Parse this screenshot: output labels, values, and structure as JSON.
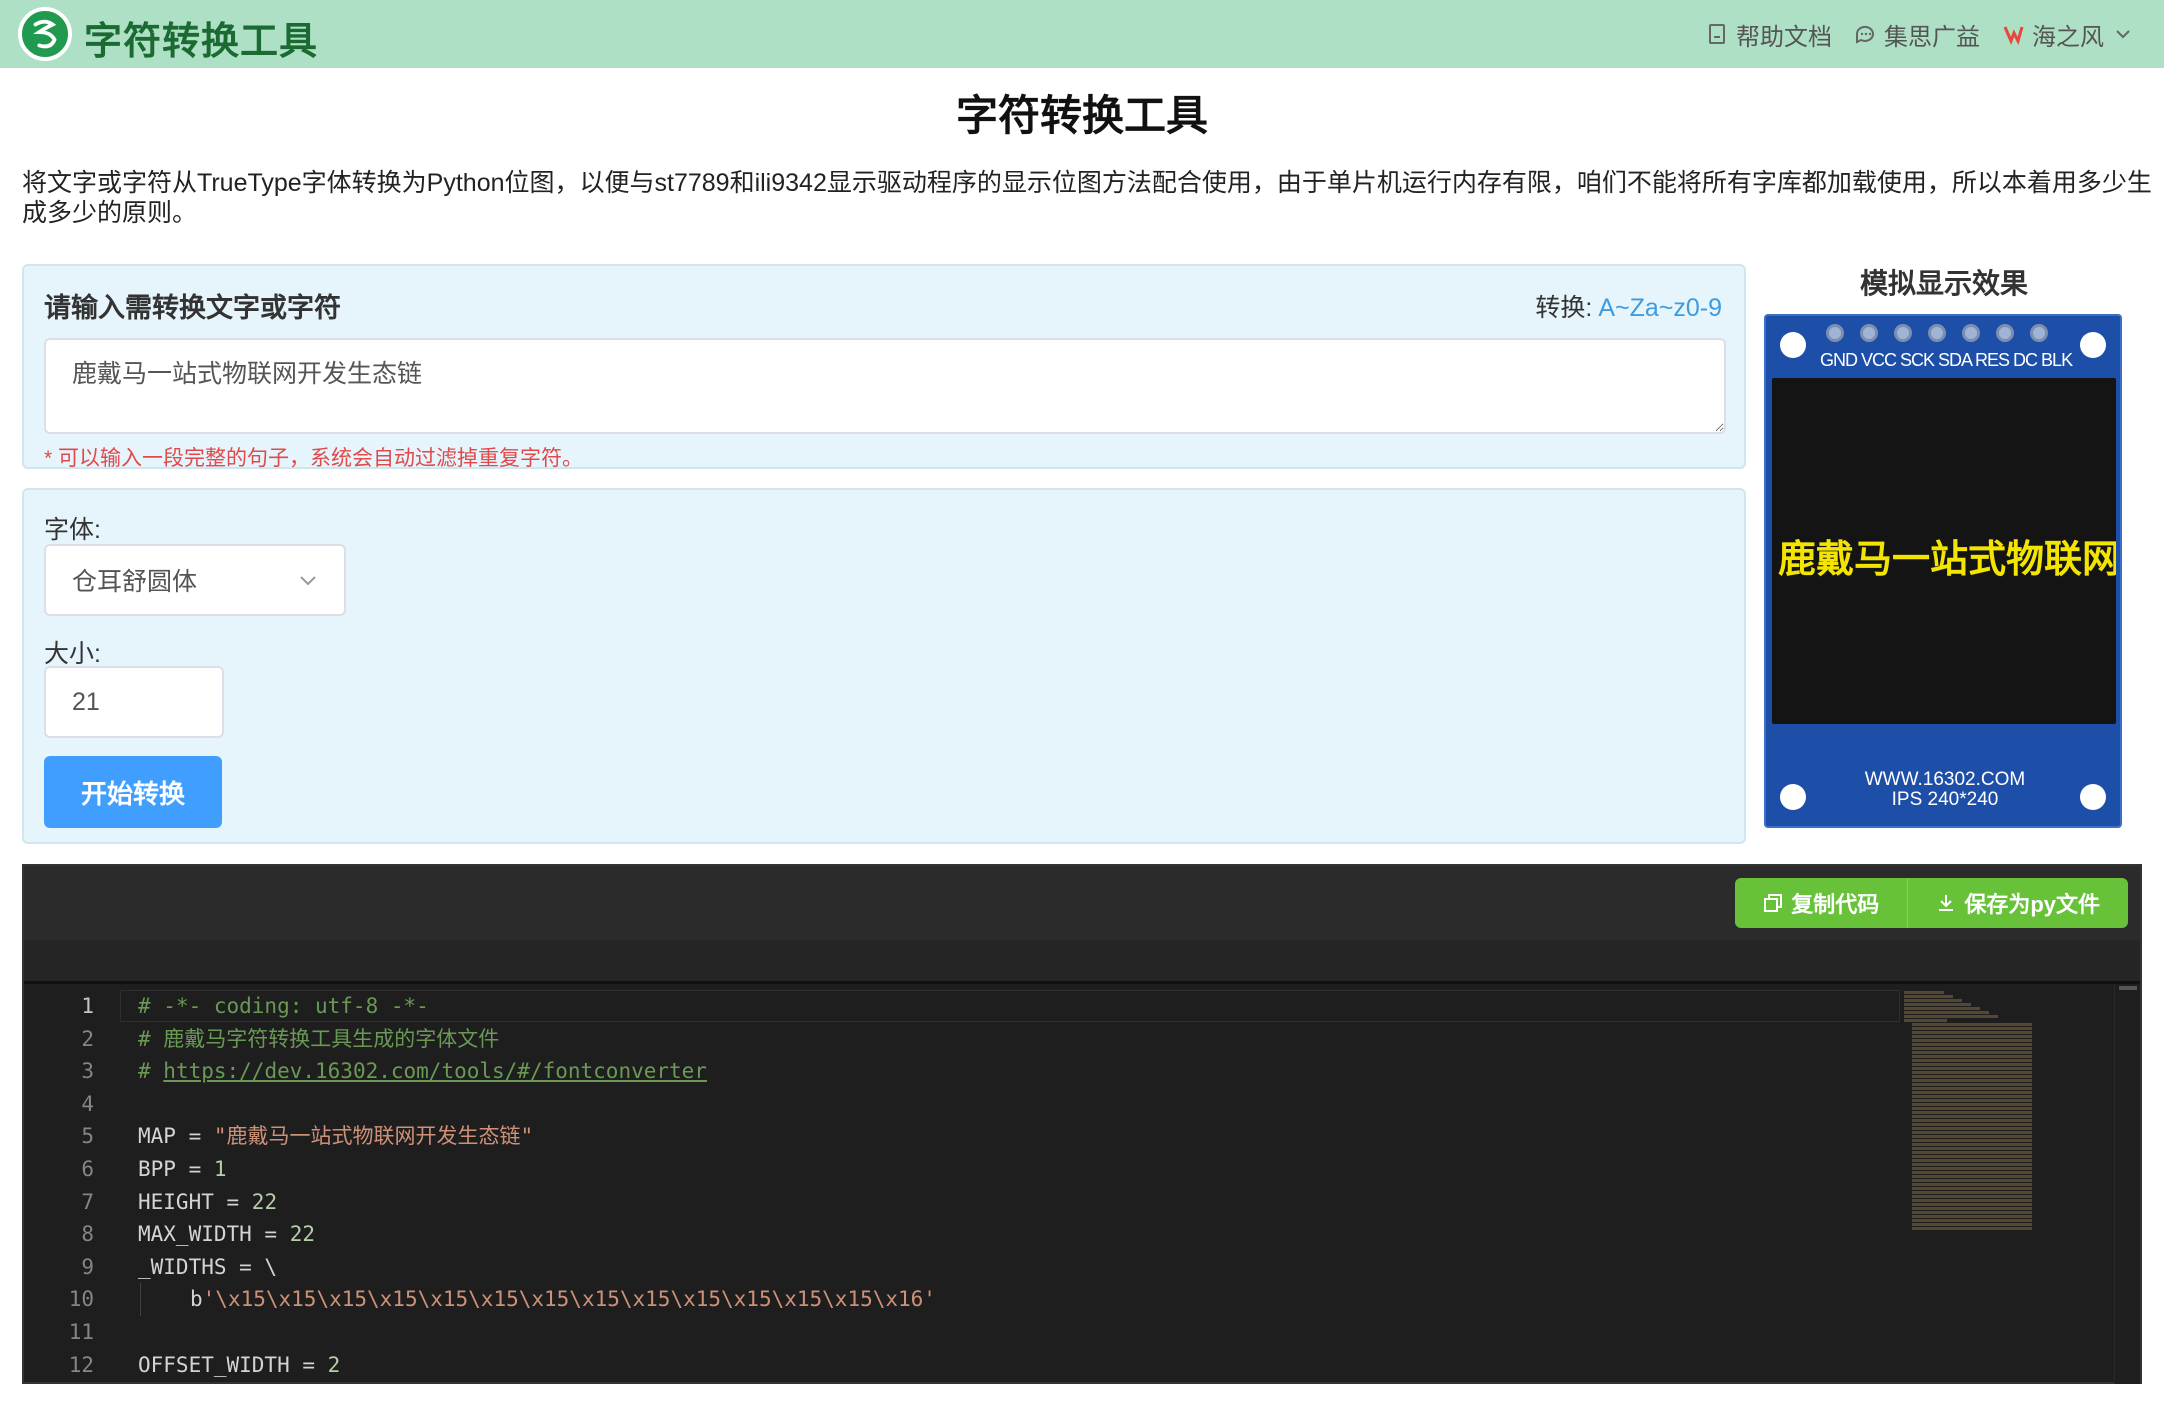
{
  "topbar": {
    "brand": "字符转换工具",
    "nav": [
      {
        "icon": "document-icon",
        "label": "帮助文档"
      },
      {
        "icon": "chat-icon",
        "label": "集思广益"
      },
      {
        "icon": "user-logo-icon",
        "label": "海之风"
      }
    ]
  },
  "page": {
    "title": "字符转换工具",
    "description": "将文字或字符从TrueType字体转换为Python位图，以便与st7789和ili9342显示驱动程序的显示位图方法配合使用，由于单片机运行内存有限，咱们不能将所有字库都加载使用，所以本着用多少生成多少的原则。"
  },
  "input_panel": {
    "title": "请输入需转换文字或字符",
    "convert_label": "转换:",
    "convert_link": "A~Za~z0-9",
    "text_value": "鹿戴马一站式物联网开发生态链",
    "hint": "* 可以输入一段完整的句子，系统会自动过滤掉重复字符。"
  },
  "settings_panel": {
    "font_label": "字体:",
    "font_value": "仓耳舒圆体",
    "size_label": "大小:",
    "size_value": "21",
    "start_button": "开始转换"
  },
  "preview": {
    "title": "模拟显示效果",
    "pin_labels": "GND VCC SCK SDA RES DC BLK",
    "screen_text": "鹿戴马一站式物联网",
    "bottom_line1": "WWW.16302.COM",
    "bottom_line2": "IPS 240*240"
  },
  "code": {
    "copy_button": "复制代码",
    "save_button": "保存为py文件",
    "lines": [
      {
        "n": "1",
        "text": "# -*- coding: utf-8 -*-"
      },
      {
        "n": "2",
        "text": "# 鹿戴马字符转换工具生成的字体文件"
      },
      {
        "n": "3",
        "text": "https://dev.16302.com/tools/#/fontconverter"
      },
      {
        "n": "4",
        "text": ""
      },
      {
        "n": "5",
        "text": "\"鹿戴马一站式物联网开发生态链\""
      },
      {
        "n": "6",
        "text": "1"
      },
      {
        "n": "7",
        "text": "22"
      },
      {
        "n": "8",
        "text": "22"
      },
      {
        "n": "9",
        "text": "_WIDTHS = \\"
      },
      {
        "n": "10",
        "text": "'\\x15\\x15\\x15\\x15\\x15\\x15\\x15\\x15\\x15\\x15\\x15\\x15\\x15\\x16'"
      },
      {
        "n": "11",
        "text": ""
      },
      {
        "n": "12",
        "text": "2"
      }
    ],
    "keywords": {
      "map": "MAP = ",
      "bpp": "BPP = ",
      "height": "HEIGHT = ",
      "max_width": "MAX_WIDTH = ",
      "b_prefix": "b",
      "offset_width": "OFFSET_WIDTH = ",
      "comment_prefix": "# "
    }
  }
}
